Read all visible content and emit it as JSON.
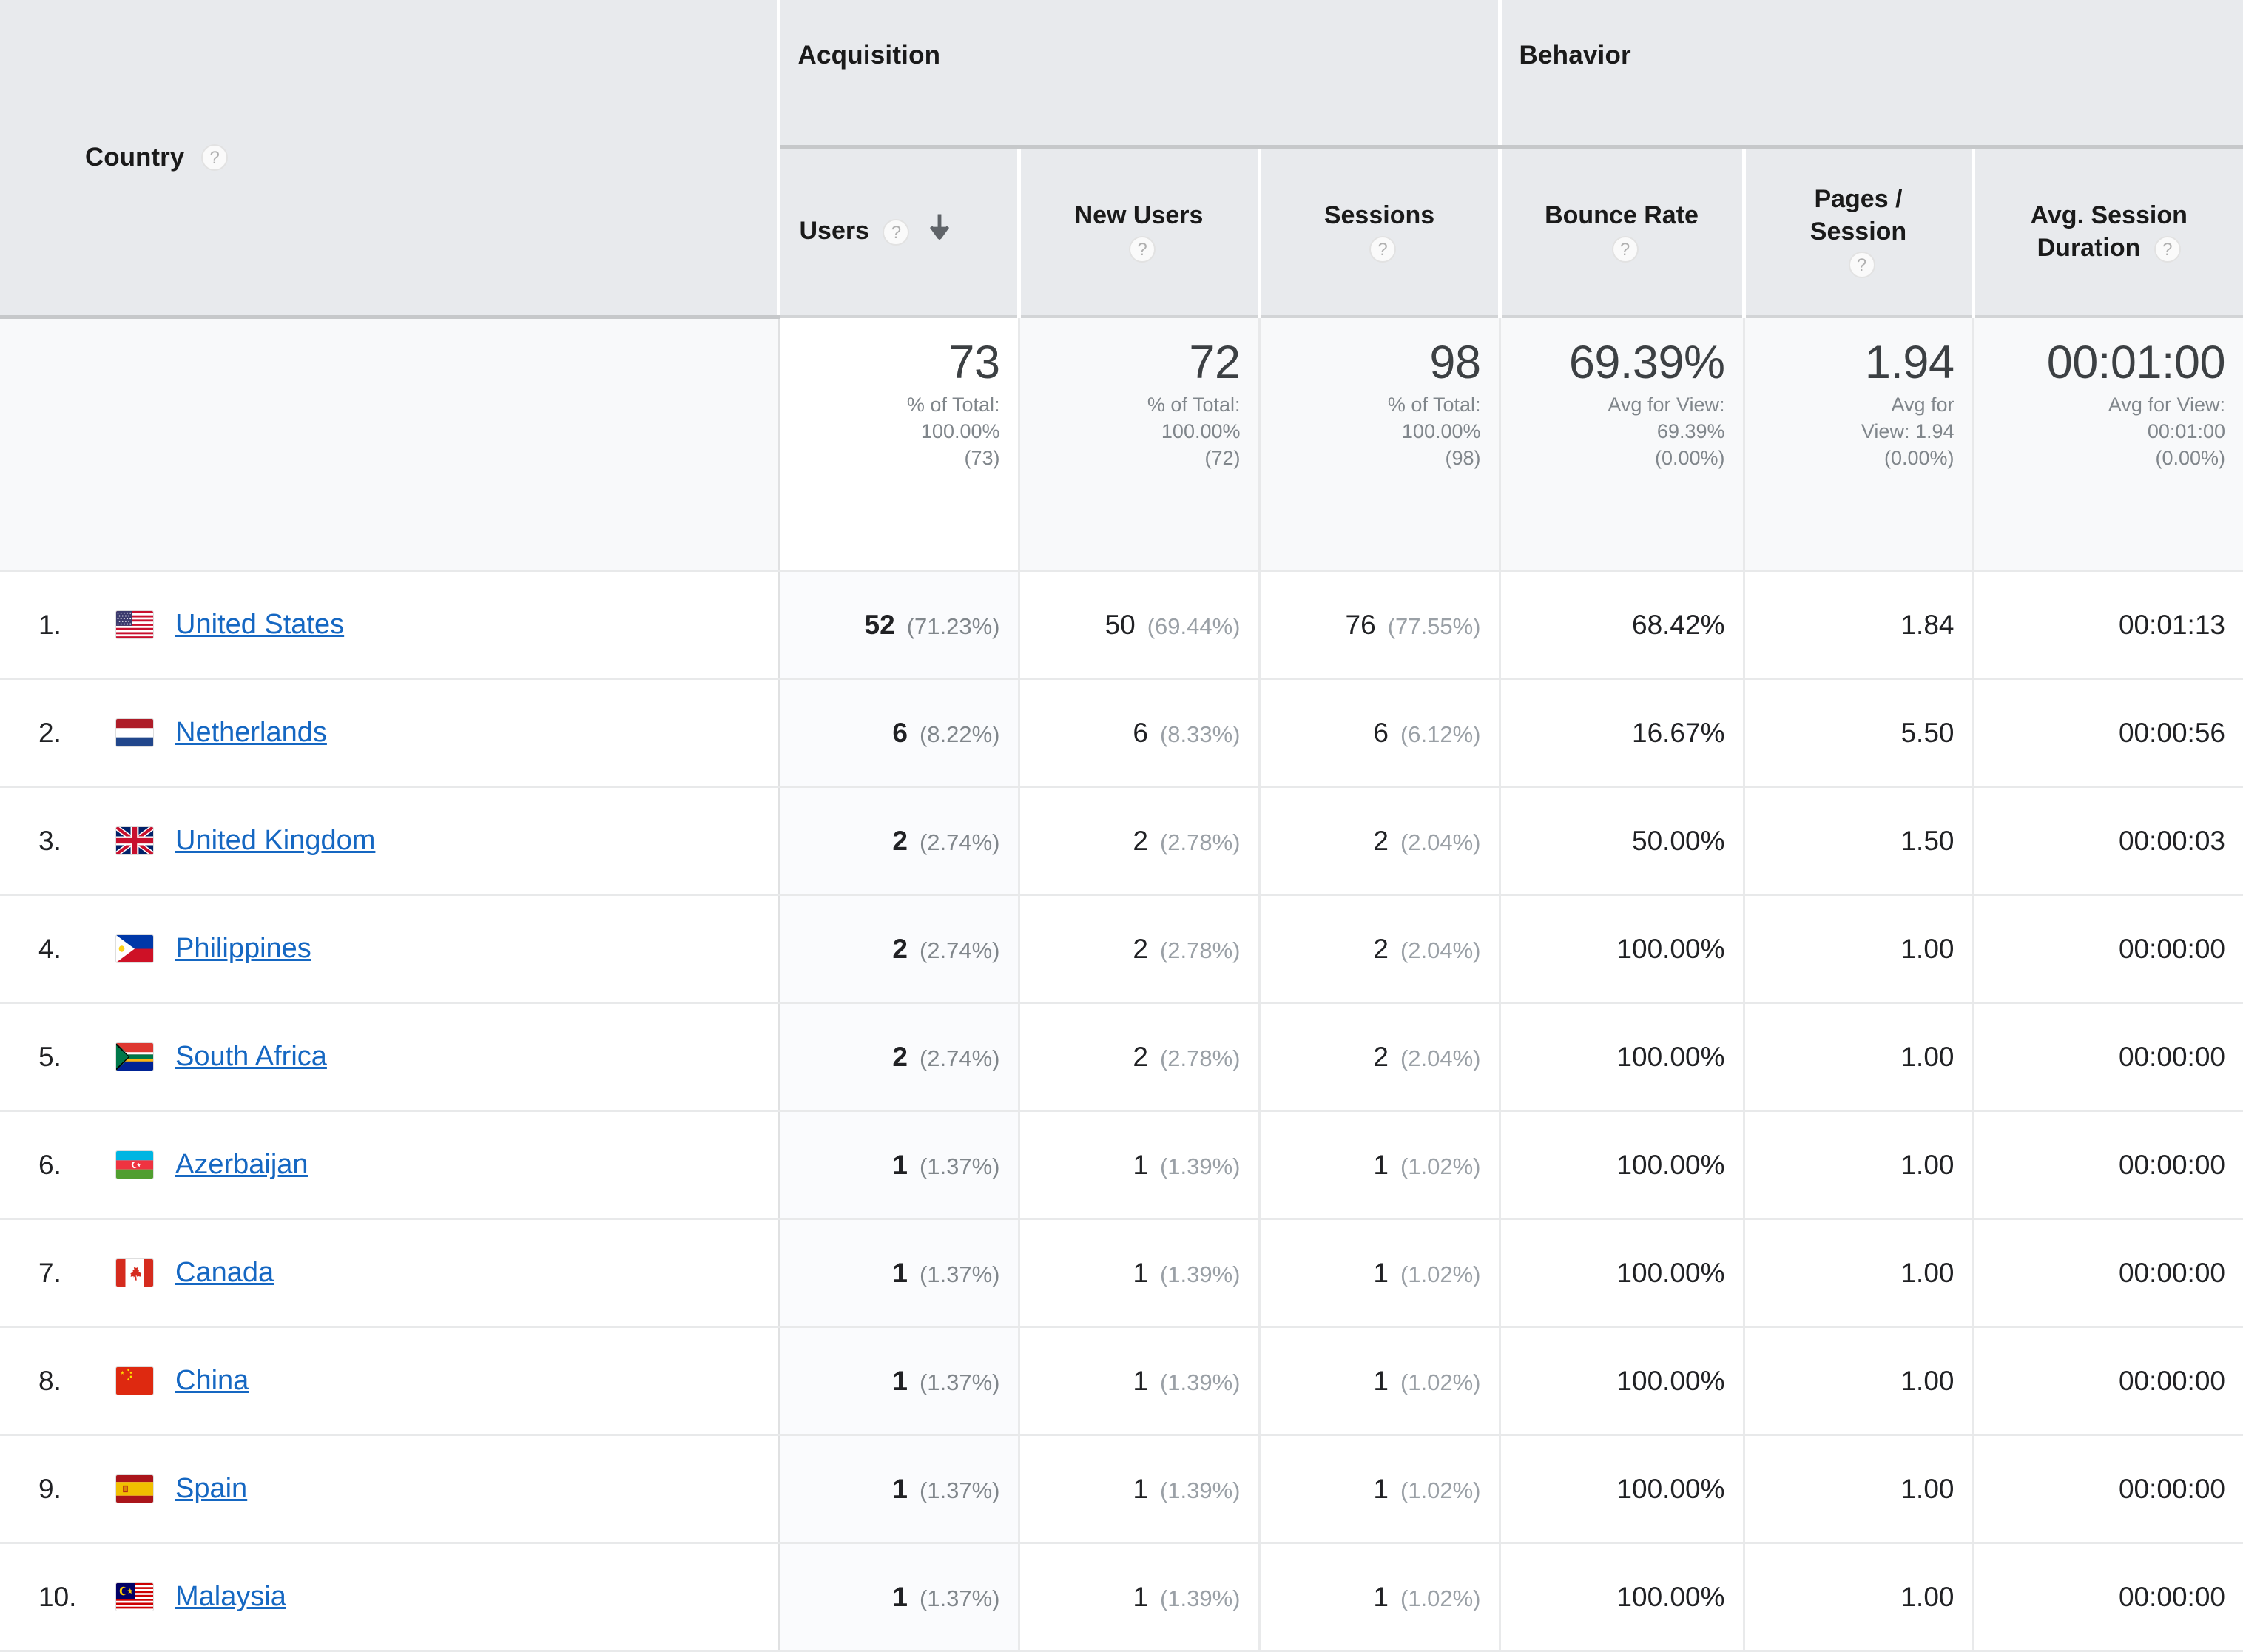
{
  "table": {
    "dimension_header": {
      "label": "Country",
      "help_icon": "help-circle-icon"
    },
    "groups": [
      {
        "name": "Acquisition",
        "span": 3
      },
      {
        "name": "Behavior",
        "span": 3
      }
    ],
    "metric_headers": [
      {
        "label": "Users",
        "help_icon": "help-circle-icon",
        "sorted": true,
        "sort_icon": "arrow-down-icon"
      },
      {
        "label": "New Users",
        "help_icon": "help-circle-icon",
        "sorted": false
      },
      {
        "label": "Sessions",
        "help_icon": "help-circle-icon",
        "sorted": false
      },
      {
        "label": "Bounce Rate",
        "help_icon": "help-circle-icon",
        "sorted": false
      },
      {
        "label": "Pages / Session",
        "line1": "Pages /",
        "line2": "Session",
        "help_icon": "help-circle-icon",
        "sorted": false
      },
      {
        "label": "Avg. Session Duration",
        "line1": "Avg. Session",
        "line2": "Duration",
        "help_icon": "help-circle-icon",
        "sorted": false
      }
    ],
    "summary": [
      {
        "value": "73",
        "caption": "% of Total:",
        "detail": "100.00%",
        "paren": "(73)"
      },
      {
        "value": "72",
        "caption": "% of Total:",
        "detail": "100.00%",
        "paren": "(72)"
      },
      {
        "value": "98",
        "caption": "% of Total:",
        "detail": "100.00%",
        "paren": "(98)"
      },
      {
        "value": "69.39%",
        "caption": "Avg for View:",
        "detail": "69.39%",
        "paren": "(0.00%)"
      },
      {
        "value": "1.94",
        "caption": "Avg for",
        "detail": "View: 1.94",
        "paren": "(0.00%)"
      },
      {
        "value": "00:01:00",
        "caption": "Avg for View:",
        "detail": "00:01:00",
        "paren": "(0.00%)"
      }
    ],
    "rows": [
      {
        "rank": "1.",
        "country": "United States",
        "flag": "flag-us",
        "users": "52",
        "users_pct": "(71.23%)",
        "new_users": "50",
        "new_users_pct": "(69.44%)",
        "sessions": "76",
        "sessions_pct": "(77.55%)",
        "bounce_rate": "68.42%",
        "pages_session": "1.84",
        "avg_duration": "00:01:13"
      },
      {
        "rank": "2.",
        "country": "Netherlands",
        "flag": "flag-nl",
        "users": "6",
        "users_pct": "(8.22%)",
        "new_users": "6",
        "new_users_pct": "(8.33%)",
        "sessions": "6",
        "sessions_pct": "(6.12%)",
        "bounce_rate": "16.67%",
        "pages_session": "5.50",
        "avg_duration": "00:00:56"
      },
      {
        "rank": "3.",
        "country": "United Kingdom",
        "flag": "flag-gb",
        "users": "2",
        "users_pct": "(2.74%)",
        "new_users": "2",
        "new_users_pct": "(2.78%)",
        "sessions": "2",
        "sessions_pct": "(2.04%)",
        "bounce_rate": "50.00%",
        "pages_session": "1.50",
        "avg_duration": "00:00:03"
      },
      {
        "rank": "4.",
        "country": "Philippines",
        "flag": "flag-ph",
        "users": "2",
        "users_pct": "(2.74%)",
        "new_users": "2",
        "new_users_pct": "(2.78%)",
        "sessions": "2",
        "sessions_pct": "(2.04%)",
        "bounce_rate": "100.00%",
        "pages_session": "1.00",
        "avg_duration": "00:00:00"
      },
      {
        "rank": "5.",
        "country": "South Africa",
        "flag": "flag-za",
        "users": "2",
        "users_pct": "(2.74%)",
        "new_users": "2",
        "new_users_pct": "(2.78%)",
        "sessions": "2",
        "sessions_pct": "(2.04%)",
        "bounce_rate": "100.00%",
        "pages_session": "1.00",
        "avg_duration": "00:00:00"
      },
      {
        "rank": "6.",
        "country": "Azerbaijan",
        "flag": "flag-az",
        "users": "1",
        "users_pct": "(1.37%)",
        "new_users": "1",
        "new_users_pct": "(1.39%)",
        "sessions": "1",
        "sessions_pct": "(1.02%)",
        "bounce_rate": "100.00%",
        "pages_session": "1.00",
        "avg_duration": "00:00:00"
      },
      {
        "rank": "7.",
        "country": "Canada",
        "flag": "flag-ca",
        "users": "1",
        "users_pct": "(1.37%)",
        "new_users": "1",
        "new_users_pct": "(1.39%)",
        "sessions": "1",
        "sessions_pct": "(1.02%)",
        "bounce_rate": "100.00%",
        "pages_session": "1.00",
        "avg_duration": "00:00:00"
      },
      {
        "rank": "8.",
        "country": "China",
        "flag": "flag-cn",
        "users": "1",
        "users_pct": "(1.37%)",
        "new_users": "1",
        "new_users_pct": "(1.39%)",
        "sessions": "1",
        "sessions_pct": "(1.02%)",
        "bounce_rate": "100.00%",
        "pages_session": "1.00",
        "avg_duration": "00:00:00"
      },
      {
        "rank": "9.",
        "country": "Spain",
        "flag": "flag-es",
        "users": "1",
        "users_pct": "(1.37%)",
        "new_users": "1",
        "new_users_pct": "(1.39%)",
        "sessions": "1",
        "sessions_pct": "(1.02%)",
        "bounce_rate": "100.00%",
        "pages_session": "1.00",
        "avg_duration": "00:00:00"
      },
      {
        "rank": "10.",
        "country": "Malaysia",
        "flag": "flag-my",
        "users": "1",
        "users_pct": "(1.37%)",
        "new_users": "1",
        "new_users_pct": "(1.39%)",
        "sessions": "1",
        "sessions_pct": "(1.02%)",
        "bounce_rate": "100.00%",
        "pages_session": "1.00",
        "avg_duration": "00:00:00"
      }
    ]
  },
  "colors": {
    "link": "#1567c2",
    "header_bg": "#e8eaed",
    "summary_bg": "#f8f9fa",
    "sorted_col_bg": "#fafbfd",
    "muted_text": "#9aa0a6"
  }
}
